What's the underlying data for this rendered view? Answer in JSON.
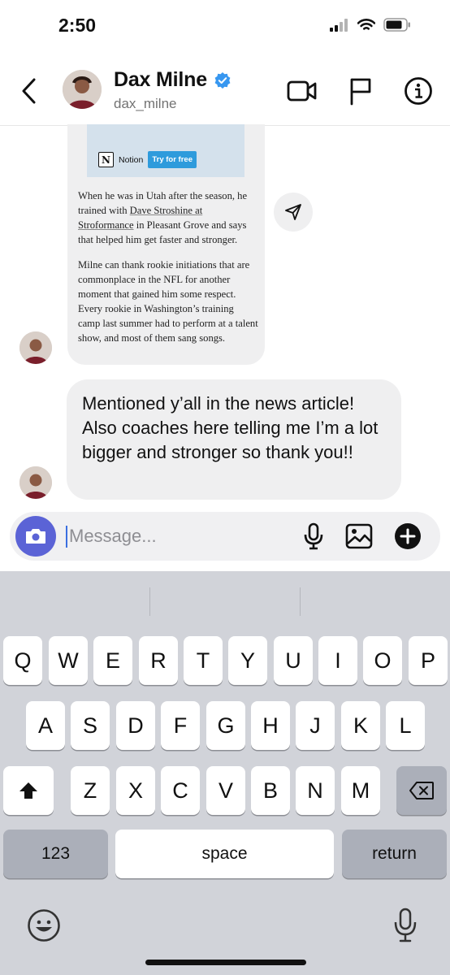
{
  "status_bar": {
    "time": "2:50"
  },
  "header": {
    "name": "Dax Milne",
    "username": "dax_milne"
  },
  "shared_post": {
    "ad_brand": "Notion",
    "ad_button": "Try for free",
    "paragraph1": {
      "before": "When he was in Utah after the season, he trained with ",
      "link": "Dave Stroshine at Stroformance",
      "after": " in Pleasant Grove and says that helped him get faster and stronger."
    },
    "paragraph2": "Milne can thank rookie initiations that are commonplace in the NFL for another moment that gained him some respect. Every rookie in Washington’s training camp last summer had to perform at a talent show, and most of them sang songs."
  },
  "message": {
    "text": "Mentioned y’all in the news article! Also coaches here telling me I’m a lot bigger and stronger so thank you!!"
  },
  "composer": {
    "placeholder": "Message..."
  },
  "keyboard": {
    "row1": [
      "Q",
      "W",
      "E",
      "R",
      "T",
      "Y",
      "U",
      "I",
      "O",
      "P"
    ],
    "row2": [
      "A",
      "S",
      "D",
      "F",
      "G",
      "H",
      "J",
      "K",
      "L"
    ],
    "row3": [
      "Z",
      "X",
      "C",
      "V",
      "B",
      "N",
      "M"
    ],
    "numbers_label": "123",
    "space_label": "space",
    "return_label": "return"
  },
  "colors": {
    "accent": "#5b63d6",
    "verified": "#3797f0",
    "bubble": "#efeff0",
    "keyboard_bg": "#d1d3d9"
  }
}
